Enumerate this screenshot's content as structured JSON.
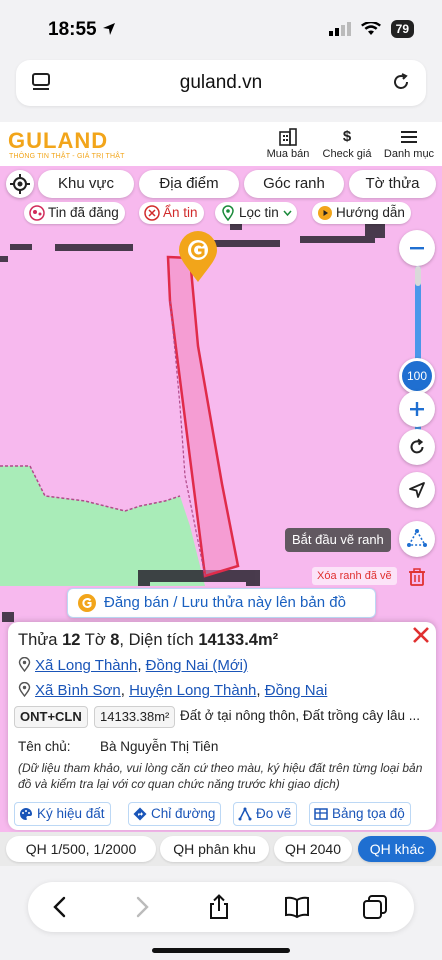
{
  "status": {
    "time": "18:55",
    "battery": "79"
  },
  "browser": {
    "url": "guland.vn"
  },
  "header": {
    "logo": "GULAND",
    "tagline": "THÔNG TIN THẬT - GIÁ TRỊ THẬT",
    "nav": {
      "buy_sell": "Mua bán",
      "check_price": "Check giá",
      "menu": "Danh mục"
    }
  },
  "filters": {
    "area": "Khu vực",
    "location": "Địa điểm",
    "corner": "Góc ranh",
    "sheet": "Tờ thửa"
  },
  "chips": {
    "posted": "Tin đã đăng",
    "hide": "Ẩn tin",
    "filter": "Lọc tin",
    "guide": "Hướng dẫn"
  },
  "map": {
    "zoom_level": "100",
    "draw_label": "Bắt đầu vẽ ranh",
    "erase_label": "Xóa ranh đã vẽ",
    "save_banner": "Đăng bán / Lưu thửa này lên bản đồ"
  },
  "parcel": {
    "label_thua": "Thửa",
    "number": "12",
    "label_to": "Tờ",
    "sheet": "8",
    "label_area": "Diện tích",
    "area": "14133.4m²",
    "new_address": {
      "commune": "Xã Long Thành",
      "province": "Đồng Nai (Mới)"
    },
    "old_address": {
      "commune": "Xã Bình Sơn",
      "district": "Huyện Long Thành",
      "province": "Đồng Nai"
    },
    "land_code": "ONT+CLN",
    "land_area": "14133.38m²",
    "land_desc": "Đất ở tại nông thôn, Đất trồng cây lâu ...",
    "owner_label": "Tên chủ:",
    "owner": "Bà Nguyễn Thị Tiên",
    "disclaimer": "(Dữ liệu tham khảo, vui lòng căn cứ theo màu, ký hiệu đất trên từng loại bản đồ và kiểm tra lại với cơ quan chức năng trước khi giao dịch)",
    "actions": {
      "legend": "Ký hiệu đất",
      "directions": "Chỉ đường",
      "measure": "Đo vẽ",
      "coords": "Bảng tọa độ"
    }
  },
  "qh": {
    "qh1": "QH 1/500, 1/2000",
    "qh2": "QH phân khu",
    "qh3": "QH 2040",
    "qh4": "QH khác"
  },
  "colors": {
    "brand": "#f2a51a",
    "accent": "#1f6fd1",
    "map_pink": "#f7b9ee",
    "map_green": "#a9ecb8"
  }
}
